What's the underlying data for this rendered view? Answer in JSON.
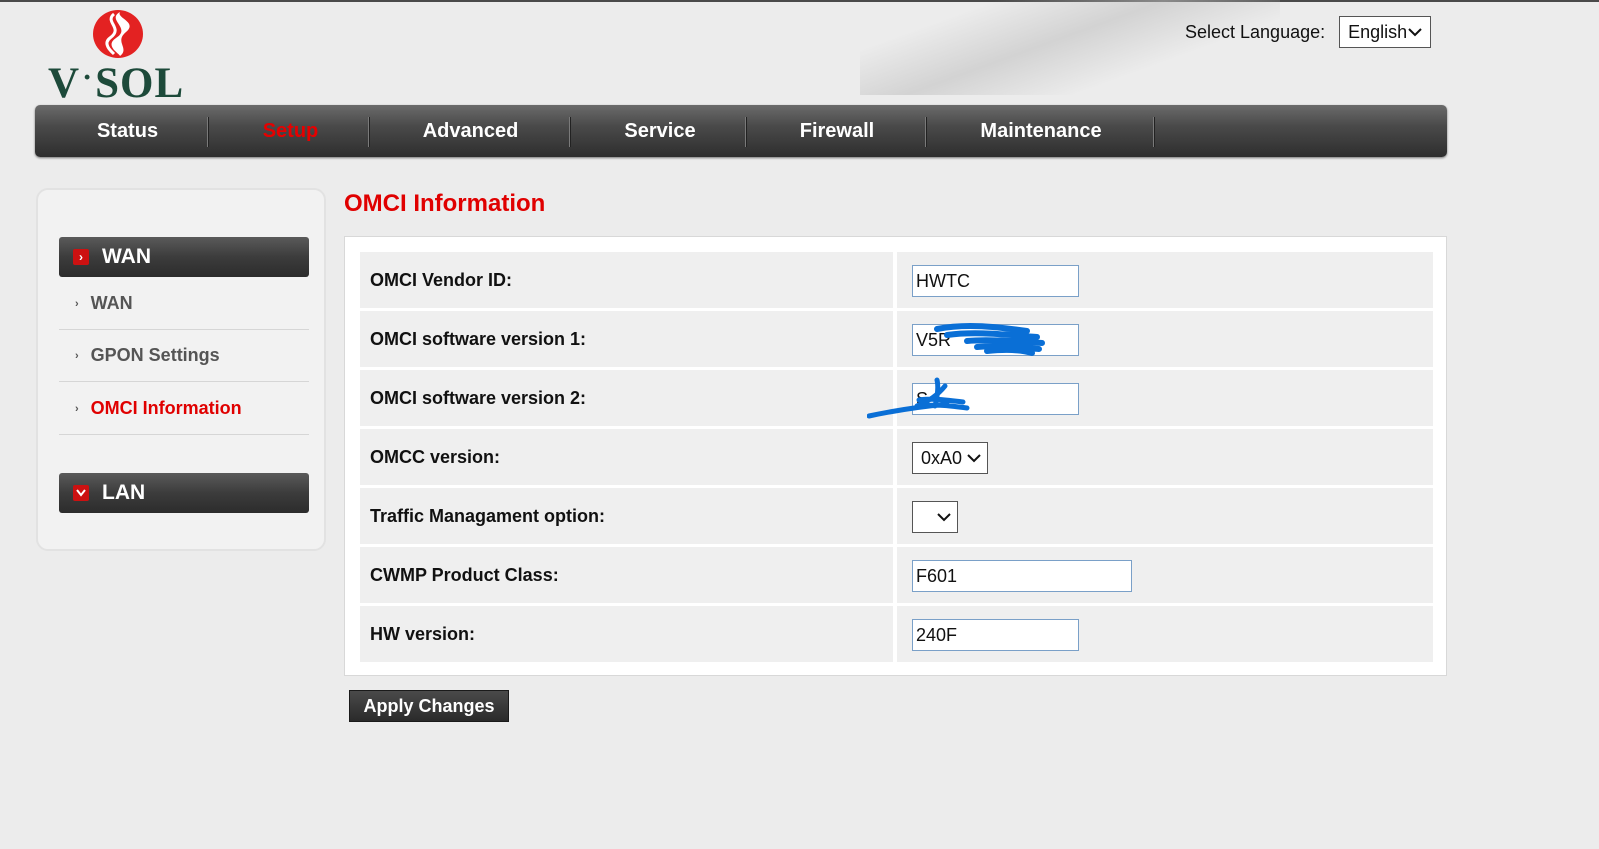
{
  "brand": {
    "logo_text": "V·SOL",
    "accent_color": "#e00000"
  },
  "language": {
    "label": "Select Language:",
    "selected": "English"
  },
  "nav": {
    "items": [
      {
        "label": "Status"
      },
      {
        "label": "Setup",
        "active": true
      },
      {
        "label": "Advanced"
      },
      {
        "label": "Service"
      },
      {
        "label": "Firewall"
      },
      {
        "label": "Maintenance"
      }
    ]
  },
  "sidebar": {
    "groups": [
      {
        "label": "WAN",
        "expanded": true,
        "items": [
          {
            "label": "WAN"
          },
          {
            "label": "GPON Settings"
          },
          {
            "label": "OMCI Information",
            "active": true
          }
        ]
      },
      {
        "label": "LAN",
        "expanded": false
      }
    ]
  },
  "page": {
    "title": "OMCI Information"
  },
  "form": {
    "rows": [
      {
        "label": "OMCI Vendor ID:",
        "value": "HWTC"
      },
      {
        "label": "OMCI software version 1:",
        "value": "V5R"
      },
      {
        "label": "OMCI software version 2:",
        "value": "S"
      },
      {
        "label": "OMCC version:",
        "value": "0xA0"
      },
      {
        "label": "Traffic Managament option:",
        "value": ""
      },
      {
        "label": "CWMP Product Class:",
        "value": "F601"
      },
      {
        "label": "HW version:",
        "value": "240F"
      }
    ]
  },
  "actions": {
    "apply_label": "Apply Changes"
  }
}
